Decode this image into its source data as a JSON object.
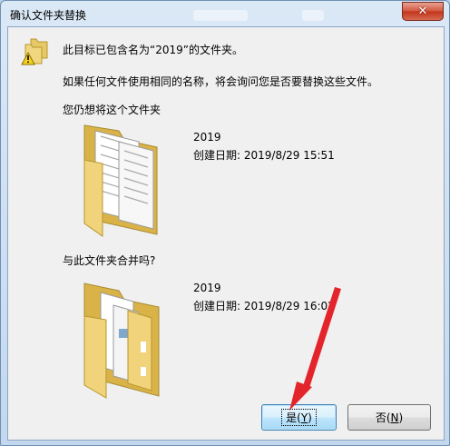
{
  "window": {
    "title": "确认文件夹替换"
  },
  "dialog": {
    "message_line1": "此目标已包含名为“2019”的文件夹。",
    "message_line2": "如果任何文件使用相同的名称，将会询问您是否要替换这些文件。",
    "question1": "您仍想将这个文件夹",
    "question2": "与此文件夹合并吗?",
    "source_folder": {
      "name": "2019",
      "created": "创建日期: 2019/8/29 15:51"
    },
    "target_folder": {
      "name": "2019",
      "created": "创建日期: 2019/8/29 16:02"
    }
  },
  "buttons": {
    "yes": {
      "label": "是(",
      "accel": "Y",
      "end": ")"
    },
    "no": {
      "label": "否(",
      "accel": "N",
      "end": ")"
    }
  },
  "icons": {
    "close": "close-icon",
    "folders": "folders-warning-icon",
    "folder": "folder-icon"
  }
}
